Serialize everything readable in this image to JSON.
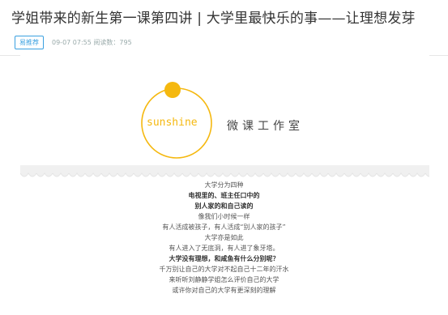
{
  "article": {
    "title": "学姐带来的新生第一课第四讲 | 大学里最快乐的事——让理想发芽",
    "badge": "易推荐",
    "meta": "09-07 07:55   阅读数：795"
  },
  "banner": {
    "logo_text": "sunshine",
    "studio_name": "微课工作室",
    "colors": {
      "accent": "#f5b80f",
      "text": "#444444"
    }
  },
  "content": {
    "lines": [
      {
        "text": "大学分为四种",
        "bold": false
      },
      {
        "text": "电视里的、班主任口中的",
        "bold": true
      },
      {
        "text": "别人家的和自己读的",
        "bold": true
      },
      {
        "text": "像我们小时候一样",
        "bold": false
      },
      {
        "text": "有人活成被孩子，有人活成“别人家的孩子”",
        "bold": false
      },
      {
        "text": "大学亦是如此",
        "bold": false
      },
      {
        "text": "有人进入了无底洞，有人进了象牙塔。",
        "bold": false
      },
      {
        "text": "大学没有理想，和咸鱼有什么分别呢？",
        "bold": true
      },
      {
        "text": "千万别让自己的大学对不起自己十二年的汗水",
        "bold": false
      },
      {
        "text": "来听听刘静静学姐怎么评价自己的大学",
        "bold": false
      },
      {
        "text": "或许你对自己的大学有更深刻的理解",
        "bold": false
      }
    ]
  }
}
